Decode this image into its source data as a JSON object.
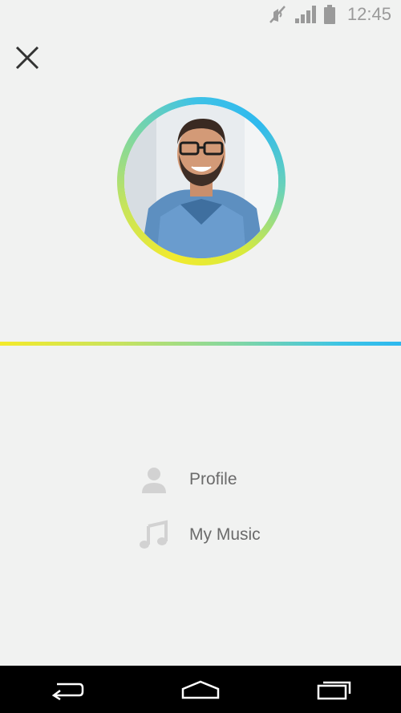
{
  "status_bar": {
    "time": "12:45",
    "icons": [
      "mute-vibrate-icon",
      "signal-icon",
      "battery-icon"
    ]
  },
  "header": {
    "close_icon": "close-icon"
  },
  "profile": {
    "avatar_alt": "profile-photo",
    "ring_colors": [
      "#f2ea2e",
      "#7fd7a0",
      "#2fb9ee"
    ]
  },
  "divider": {
    "gradient": [
      "#f4ea2a",
      "#2db8ef"
    ]
  },
  "menu": {
    "items": [
      {
        "icon": "person-icon",
        "label": "Profile"
      },
      {
        "icon": "music-note-icon",
        "label": "My Music"
      }
    ]
  },
  "nav_bar": {
    "buttons": [
      "back-icon",
      "home-icon",
      "recent-apps-icon"
    ]
  }
}
